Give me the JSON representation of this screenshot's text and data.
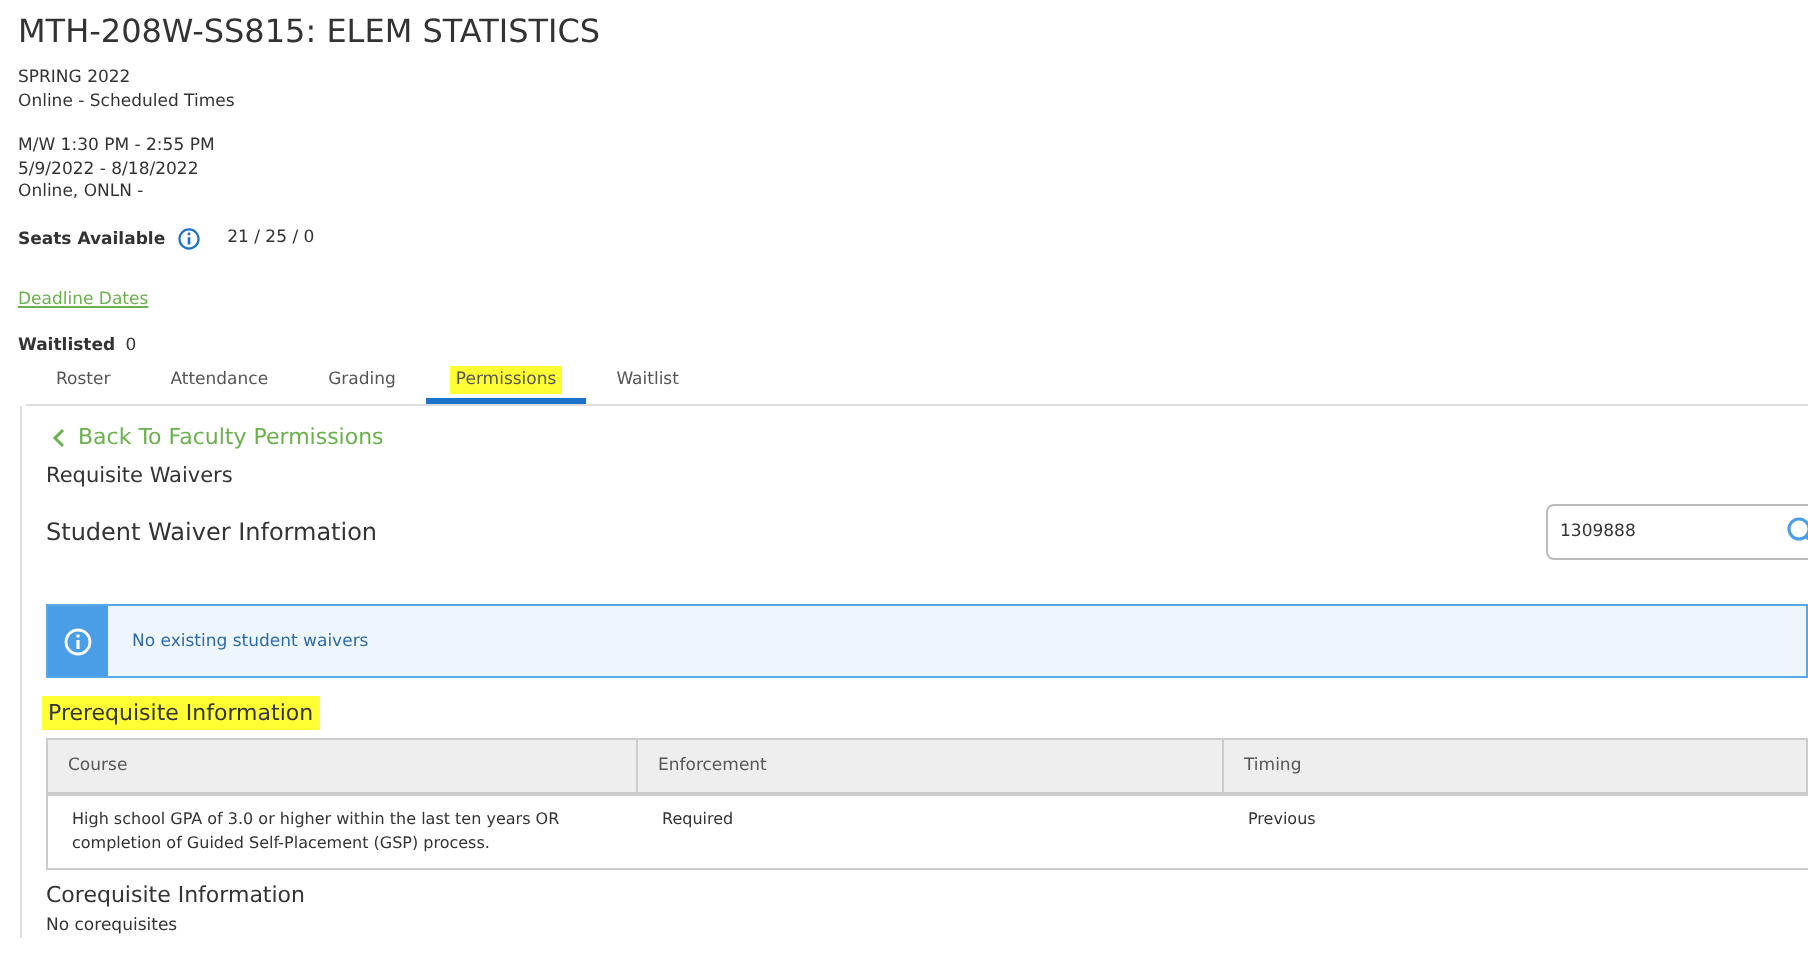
{
  "title": "MTH-208W-SS815: ELEM STATISTICS",
  "term_lines": [
    "SPRING 2022",
    "Online - Scheduled Times"
  ],
  "schedule_lines": [
    "M/W 1:30 PM - 2:55 PM",
    "5/9/2022 - 8/18/2022",
    "Online, ONLN -"
  ],
  "seats": {
    "label": "Seats Available",
    "value": "21 / 25 / 0"
  },
  "deadline_link": "Deadline Dates",
  "waitlisted": {
    "label": "Waitlisted",
    "value": "0"
  },
  "tabs": [
    {
      "label": "Roster",
      "selected": false,
      "highlighted": false
    },
    {
      "label": "Attendance",
      "selected": false,
      "highlighted": false
    },
    {
      "label": "Grading",
      "selected": false,
      "highlighted": false
    },
    {
      "label": "Permissions",
      "selected": true,
      "highlighted": true
    },
    {
      "label": "Waitlist",
      "selected": false,
      "highlighted": false
    }
  ],
  "back_link": "Back To Faculty Permissions",
  "section_title": "Requisite Waivers",
  "waiver_heading": "Student Waiver Information",
  "search": {
    "value": "1309888"
  },
  "info_message": "No existing student waivers",
  "prerequisite": {
    "heading": "Prerequisite Information",
    "highlighted": true,
    "columns": [
      "Course",
      "Enforcement",
      "Timing"
    ],
    "rows": [
      [
        "High school GPA of 3.0 or higher within the last ten years OR completion of Guided Self-Placement (GSP) process.",
        "Required",
        "Previous"
      ]
    ]
  },
  "corequisite": {
    "heading": "Corequisite Information",
    "message": "No corequisites"
  }
}
